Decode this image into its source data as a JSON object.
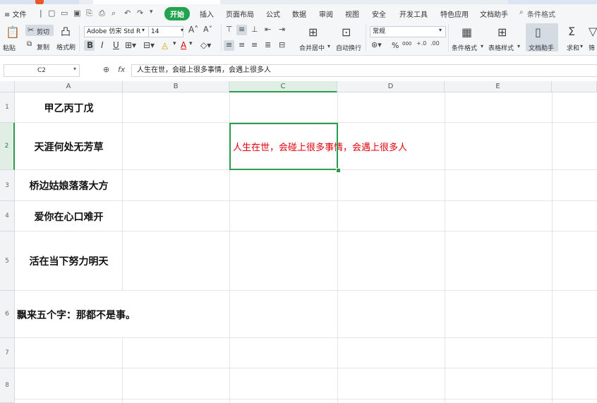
{
  "menu": {
    "file": "≡ 文件",
    "tabs": [
      "开始",
      "插入",
      "页面布局",
      "公式",
      "数据",
      "审阅",
      "视图",
      "安全",
      "开发工具",
      "特色应用",
      "文档助手"
    ],
    "active_tab": "开始",
    "search_label": "条件格式"
  },
  "ribbon": {
    "paste": "粘贴",
    "cut": "剪切",
    "copy": "复制",
    "format_painter": "格式刷",
    "font_name": "Adobe 仿宋 Std R",
    "font_size": "14",
    "merge_center": "合并居中",
    "wrap_text": "自动换行",
    "number_format": "常规",
    "percent": "%",
    "thousands": "000",
    "conditional_format": "条件格式",
    "table_style": "表格样式",
    "doc_helper": "文档助手",
    "sum": "求和",
    "filter": "筛"
  },
  "formula_bar": {
    "name_box": "C2",
    "fx": "fx",
    "content": "人生在世，会碰上很多事情，会遇上很多人"
  },
  "sheet": {
    "columns": [
      "A",
      "B",
      "C",
      "D",
      "E"
    ],
    "selected_column": "C",
    "rows": [
      "1",
      "2",
      "3",
      "4",
      "5",
      "6",
      "7",
      "8"
    ],
    "selected_row": "2",
    "cells": {
      "A1": "甲乙丙丁戊",
      "A2": "天涯何处无芳草",
      "C2": "人生在世，会碰上很多事情，会遇上很多人",
      "A3": "桥边姑娘落落大方",
      "A4": "爱你在心口难开",
      "A5": "活在当下努力明天",
      "A6": "飘来五个字：那都不是事。"
    }
  },
  "colors": {
    "accent": "#2d9b4d",
    "red_text": "#e3000b"
  }
}
